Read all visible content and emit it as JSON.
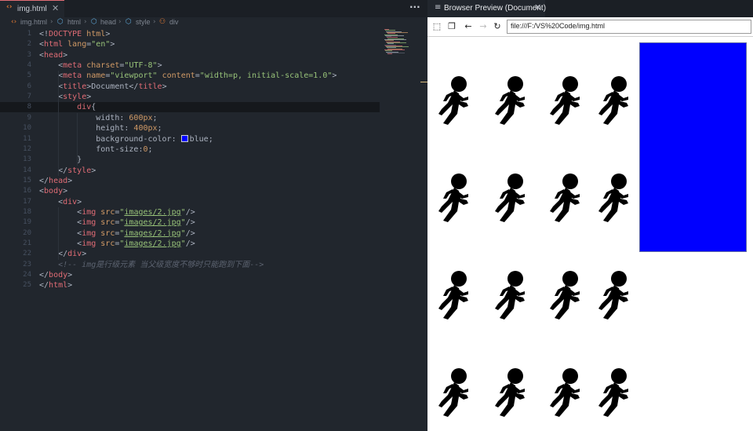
{
  "editor": {
    "tab": {
      "label": "img.html",
      "icon": "html-file-icon"
    },
    "more_label": "···",
    "breadcrumb": [
      {
        "label": "img.html",
        "icon": "html-file-icon"
      },
      {
        "label": "html",
        "icon": "element-icon"
      },
      {
        "label": "head",
        "icon": "element-icon"
      },
      {
        "label": "style",
        "icon": "element-icon"
      },
      {
        "label": "div",
        "icon": "css-rule-icon"
      }
    ],
    "active_line": 8,
    "lines": [
      {
        "n": "1",
        "tokens": [
          [
            "t-p",
            "<!"
          ],
          [
            "t-tag",
            "DOCTYPE"
          ],
          [
            "t-p",
            " "
          ],
          [
            "t-attr",
            "html"
          ],
          [
            "t-p",
            ">"
          ]
        ]
      },
      {
        "n": "2",
        "tokens": [
          [
            "t-p",
            "<"
          ],
          [
            "t-tag",
            "html"
          ],
          [
            "t-p",
            " "
          ],
          [
            "t-attr",
            "lang"
          ],
          [
            "t-p",
            "="
          ],
          [
            "t-str",
            "\"en\""
          ],
          [
            "t-p",
            ">"
          ]
        ]
      },
      {
        "n": "3",
        "tokens": [
          [
            "t-p",
            "<"
          ],
          [
            "t-tag",
            "head"
          ],
          [
            "t-p",
            ">"
          ]
        ]
      },
      {
        "n": "4",
        "tokens": [
          [
            "t-p",
            "    <"
          ],
          [
            "t-tag",
            "meta"
          ],
          [
            "t-p",
            " "
          ],
          [
            "t-attr",
            "charset"
          ],
          [
            "t-p",
            "="
          ],
          [
            "t-str",
            "\"UTF-8\""
          ],
          [
            "t-p",
            ">"
          ]
        ]
      },
      {
        "n": "5",
        "tokens": [
          [
            "t-p",
            "    <"
          ],
          [
            "t-tag",
            "meta"
          ],
          [
            "t-p",
            " "
          ],
          [
            "t-attr",
            "name"
          ],
          [
            "t-p",
            "="
          ],
          [
            "t-str",
            "\"viewport\""
          ],
          [
            "t-p",
            " "
          ],
          [
            "t-attr",
            "content"
          ],
          [
            "t-p",
            "="
          ],
          [
            "t-str",
            "\"width=p, initial-scale=1.0\""
          ],
          [
            "t-p",
            ">"
          ]
        ]
      },
      {
        "n": "6",
        "tokens": [
          [
            "t-p",
            "    <"
          ],
          [
            "t-tag",
            "title"
          ],
          [
            "t-p",
            ">Document</"
          ],
          [
            "t-tag",
            "title"
          ],
          [
            "t-p",
            ">"
          ]
        ]
      },
      {
        "n": "7",
        "tokens": [
          [
            "t-p",
            "    <"
          ],
          [
            "t-tag",
            "style"
          ],
          [
            "t-p",
            ">"
          ]
        ]
      },
      {
        "n": "8",
        "tokens": [
          [
            "t-sel",
            "        div"
          ],
          [
            "t-p",
            "{"
          ]
        ]
      },
      {
        "n": "9",
        "tokens": [
          [
            "t-prop",
            "            width"
          ],
          [
            "t-p",
            ": "
          ],
          [
            "t-num",
            "600px"
          ],
          [
            "t-p",
            ";"
          ]
        ]
      },
      {
        "n": "10",
        "tokens": [
          [
            "t-prop",
            "            height"
          ],
          [
            "t-p",
            ": "
          ],
          [
            "t-num",
            "400px"
          ],
          [
            "t-p",
            ";"
          ]
        ]
      },
      {
        "n": "11",
        "tokens": [
          [
            "t-prop",
            "            background-color"
          ],
          [
            "t-p",
            ": "
          ],
          [
            "swatch",
            ""
          ],
          [
            "t-p",
            "blue;"
          ]
        ]
      },
      {
        "n": "12",
        "tokens": [
          [
            "t-prop",
            "            font-size"
          ],
          [
            "t-p",
            ":"
          ],
          [
            "t-num",
            "0"
          ],
          [
            "t-p",
            ";"
          ]
        ]
      },
      {
        "n": "13",
        "tokens": [
          [
            "t-p",
            "        }"
          ]
        ]
      },
      {
        "n": "14",
        "tokens": [
          [
            "t-p",
            "    </"
          ],
          [
            "t-tag",
            "style"
          ],
          [
            "t-p",
            ">"
          ]
        ]
      },
      {
        "n": "15",
        "tokens": [
          [
            "t-p",
            "</"
          ],
          [
            "t-tag",
            "head"
          ],
          [
            "t-p",
            ">"
          ]
        ]
      },
      {
        "n": "16",
        "tokens": [
          [
            "t-p",
            "<"
          ],
          [
            "t-tag",
            "body"
          ],
          [
            "t-p",
            ">"
          ]
        ]
      },
      {
        "n": "17",
        "tokens": [
          [
            "t-p",
            "    <"
          ],
          [
            "t-tag",
            "div"
          ],
          [
            "t-p",
            ">"
          ]
        ]
      },
      {
        "n": "18",
        "tokens": [
          [
            "t-p",
            "        <"
          ],
          [
            "t-tag",
            "img"
          ],
          [
            "t-p",
            " "
          ],
          [
            "t-attr",
            "src"
          ],
          [
            "t-p",
            "="
          ],
          [
            "t-str",
            "\""
          ],
          [
            "t-str-u",
            "images/2.jpg"
          ],
          [
            "t-str",
            "\""
          ],
          [
            "t-p",
            "/>"
          ]
        ]
      },
      {
        "n": "19",
        "tokens": [
          [
            "t-p",
            "        <"
          ],
          [
            "t-tag",
            "img"
          ],
          [
            "t-p",
            " "
          ],
          [
            "t-attr",
            "src"
          ],
          [
            "t-p",
            "="
          ],
          [
            "t-str",
            "\""
          ],
          [
            "t-str-u",
            "images/2.jpg"
          ],
          [
            "t-str",
            "\""
          ],
          [
            "t-p",
            "/>"
          ]
        ]
      },
      {
        "n": "20",
        "tokens": [
          [
            "t-p",
            "        <"
          ],
          [
            "t-tag",
            "img"
          ],
          [
            "t-p",
            " "
          ],
          [
            "t-attr",
            "src"
          ],
          [
            "t-p",
            "="
          ],
          [
            "t-str",
            "\""
          ],
          [
            "t-str-u",
            "images/2.jpg"
          ],
          [
            "t-str",
            "\""
          ],
          [
            "t-p",
            "/>"
          ]
        ]
      },
      {
        "n": "21",
        "tokens": [
          [
            "t-p",
            "        <"
          ],
          [
            "t-tag",
            "img"
          ],
          [
            "t-p",
            " "
          ],
          [
            "t-attr",
            "src"
          ],
          [
            "t-p",
            "="
          ],
          [
            "t-str",
            "\""
          ],
          [
            "t-str-u",
            "images/2.jpg"
          ],
          [
            "t-str",
            "\""
          ],
          [
            "t-p",
            "/>"
          ]
        ]
      },
      {
        "n": "22",
        "tokens": [
          [
            "t-p",
            "    </"
          ],
          [
            "t-tag",
            "div"
          ],
          [
            "t-p",
            ">"
          ]
        ]
      },
      {
        "n": "23",
        "tokens": [
          [
            "t-cmt",
            "    <!-- img是行级元素 当父级宽度不够时只能跑到下面-->"
          ]
        ]
      },
      {
        "n": "24",
        "tokens": [
          [
            "t-p",
            "</"
          ],
          [
            "t-tag",
            "body"
          ],
          [
            "t-p",
            ">"
          ]
        ]
      },
      {
        "n": "25",
        "tokens": [
          [
            "t-p",
            "</"
          ],
          [
            "t-tag",
            "html"
          ],
          [
            "t-p",
            ">"
          ]
        ]
      }
    ]
  },
  "preview": {
    "tab": {
      "label": "Browser Preview (Document)",
      "icon": "menu-icon"
    },
    "nav": [
      {
        "name": "inspect-icon",
        "glyph": "⬚",
        "disabled": false
      },
      {
        "name": "devtools-icon",
        "glyph": "❐",
        "disabled": false
      },
      {
        "name": "back-icon",
        "glyph": "←",
        "disabled": false
      },
      {
        "name": "forward-icon",
        "glyph": "→",
        "disabled": true
      },
      {
        "name": "reload-icon",
        "glyph": "↻",
        "disabled": false
      }
    ],
    "url": "file:///F:/VS%20Code/img.html",
    "page": {
      "box_color": "#0000ff",
      "image_rows": 4,
      "images_per_row": 4,
      "image_icon": "running-figure-icon"
    }
  },
  "colors": {
    "editor_bg": "#21262d",
    "tab_accent": "#e06c75",
    "tag": "#e06c75",
    "attribute": "#d19a66",
    "string": "#98c379",
    "comment": "#5c6370"
  }
}
